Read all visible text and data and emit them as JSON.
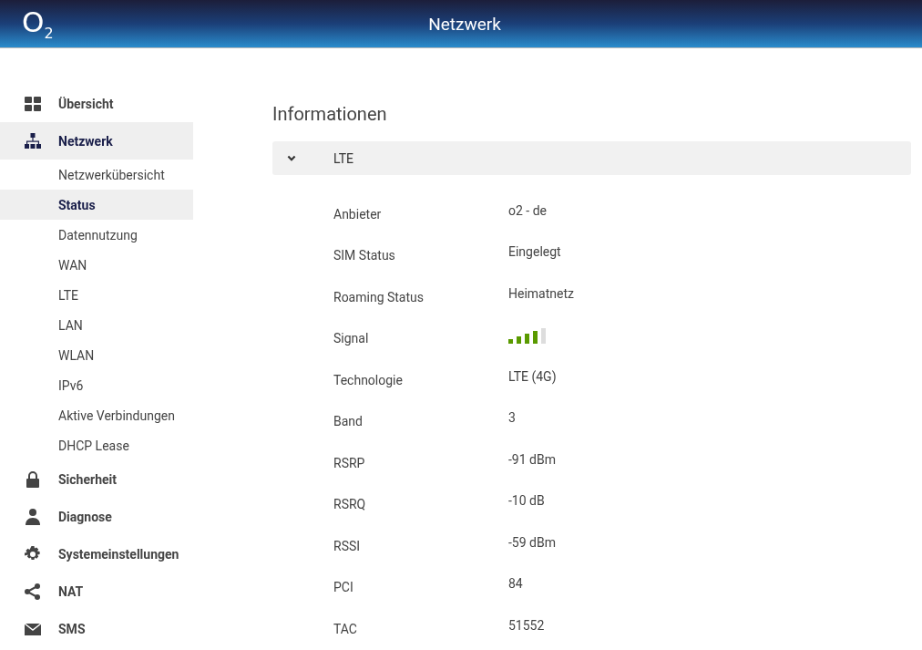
{
  "header": {
    "logo": "O$_{2}$",
    "title": "Netzwerk"
  },
  "sidebar": {
    "items": [
      {
        "label": "Übersicht",
        "selected": false
      },
      {
        "label": "Netzwerk",
        "selected": true,
        "children": [
          {
            "label": "Netzwerkübersicht",
            "selected": false
          },
          {
            "label": "Status",
            "selected": true
          },
          {
            "label": "Datennutzung",
            "selected": false
          },
          {
            "label": "WAN",
            "selected": false
          },
          {
            "label": "LTE",
            "selected": false
          },
          {
            "label": "LAN",
            "selected": false
          },
          {
            "label": "WLAN",
            "selected": false
          },
          {
            "label": "IPv6",
            "selected": false
          },
          {
            "label": "Aktive Verbindungen",
            "selected": false
          },
          {
            "label": "DHCP Lease",
            "selected": false
          }
        ]
      },
      {
        "label": "Sicherheit",
        "selected": false
      },
      {
        "label": "Diagnose",
        "selected": false
      },
      {
        "label": "Systemeinstellungen",
        "selected": false
      },
      {
        "label": "NAT",
        "selected": false
      },
      {
        "label": "SMS",
        "selected": false
      }
    ]
  },
  "main": {
    "heading": "Informationen",
    "section": {
      "title": "LTE",
      "expanded": true,
      "rows": [
        {
          "label": "Anbieter",
          "kind": "text",
          "value": "o2 - de"
        },
        {
          "label": "SIM Status",
          "kind": "text",
          "value": "Eingelegt"
        },
        {
          "label": "Roaming Status",
          "kind": "text",
          "value": "Heimatnetz"
        },
        {
          "label": "Signal",
          "kind": "signal"
        },
        {
          "label": "Technologie",
          "kind": "text",
          "value": "LTE (4G)"
        },
        {
          "label": "Band",
          "kind": "text",
          "value": "3"
        },
        {
          "label": "RSRP",
          "kind": "text",
          "value": "-91 dBm"
        },
        {
          "label": "RSRQ",
          "kind": "text",
          "value": "-10 dB"
        },
        {
          "label": "RSSI",
          "kind": "text",
          "value": "-59 dBm"
        },
        {
          "label": "PCI",
          "kind": "text",
          "value": "84"
        },
        {
          "label": "TAC",
          "kind": "text",
          "value": "51552"
        }
      ]
    }
  }
}
